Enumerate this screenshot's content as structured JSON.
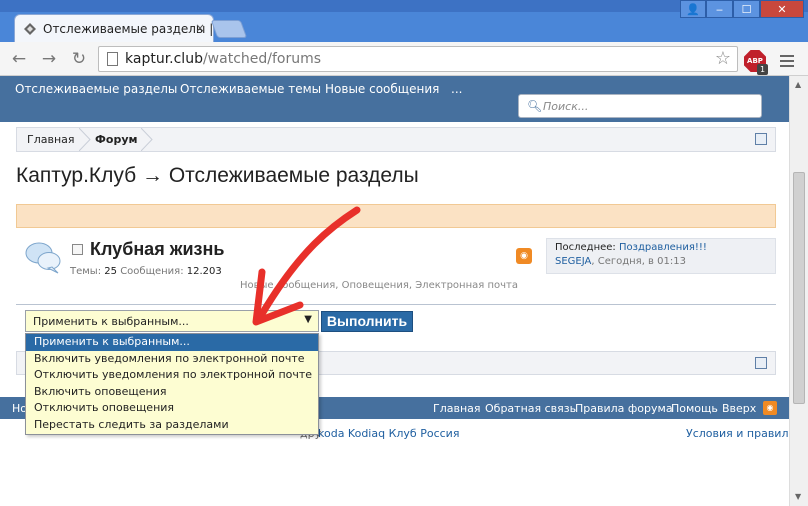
{
  "browser": {
    "tab_title": "Отслеживаемые разделы |",
    "tab_close": "×",
    "url_host": "kaptur.club",
    "url_path": "/watched/forums",
    "abp_label": "ABP",
    "abp_count": "1",
    "icons": [
      "back-arrow-icon",
      "forward-arrow-icon",
      "reload-icon",
      "page-icon",
      "star-icon",
      "adblock-icon",
      "menu-icon"
    ]
  },
  "window": {
    "user_label": "👤",
    "min_label": "‒",
    "max_label": "☐",
    "close_label": "✕"
  },
  "nav": {
    "items": [
      "Отслеживаемые разделы",
      "Отслеживаемые темы",
      "Новые сообщения",
      "..."
    ]
  },
  "search": {
    "placeholder": "Поиск..."
  },
  "breadcrumb": {
    "items": [
      "Главная",
      "Форум"
    ]
  },
  "page": {
    "title": "Каптур.Клуб → Отслеживаемые разделы"
  },
  "forum": {
    "name": "Клубная жизнь",
    "threads_label": "Темы:",
    "threads": "25",
    "posts_label": "Сообщения:",
    "posts": "12.203",
    "notify": "Новые сообщения, Оповещения, Электронная почта",
    "last_label": "Последнее:",
    "last_title": "Поздравления!!!",
    "last_user": "SEGEJA",
    "last_time": ", Сегодня, в 01:13"
  },
  "actions": {
    "select_value": "Применить к выбранным...",
    "options": [
      "Применить к выбранным...",
      "Включить уведомления по электронной почте",
      "Отключить уведомления по электронной почте",
      "Включить оповещения",
      "Отключить оповещения",
      "Перестать следить за разделами"
    ],
    "execute": "Выполнить"
  },
  "footer": {
    "left": "Но",
    "links": [
      "Главная",
      "Обратная связь",
      "Правила форума",
      "Помощь",
      "Вверх"
    ],
    "copyright_pre": "дру",
    "copyright": "koda Kodiaq Клуб Россия",
    "terms": "Условия и правила"
  },
  "colors": {
    "nav_blue": "#46709e",
    "chrome_blue": "#4a86d8",
    "button_blue": "#2a6aa6",
    "category_peach": "#fbe2c4",
    "select_yellow": "#fdfdd2",
    "annotation_red": "#e8302a"
  }
}
